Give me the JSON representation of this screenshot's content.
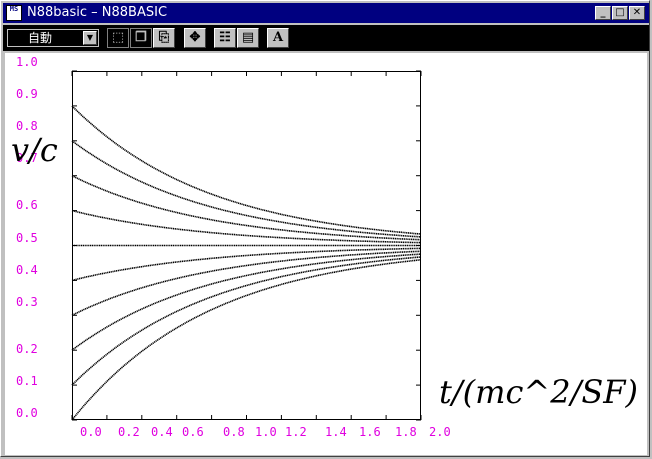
{
  "window": {
    "title": "N88basic – N88BASIC",
    "icon_text": "MS",
    "buttons": [
      "_",
      "□",
      "✕"
    ]
  },
  "toolbar": {
    "mode": "自動",
    "tools": [
      {
        "name": "select-icon",
        "glyph": "⬚"
      },
      {
        "name": "copy-icon",
        "glyph": "❐"
      },
      {
        "name": "paste-icon",
        "glyph": "⎘"
      },
      {
        "name": "fit-icon",
        "glyph": "✥"
      },
      {
        "name": "properties-icon",
        "glyph": "☷"
      },
      {
        "name": "window-icon",
        "glyph": "▤"
      },
      {
        "name": "font-icon",
        "glyph": "A"
      }
    ]
  },
  "chart_data": {
    "type": "line",
    "xlabel": "t/(mc^2/SF)",
    "ylabel": "v/c",
    "xlim": [
      0,
      2
    ],
    "ylim": [
      0,
      1
    ],
    "ytick_labels": [
      "1.0",
      "0.9",
      "0.8",
      "0.7",
      "0.6",
      "0.5",
      "0.4",
      "0.3",
      "0.2",
      "0.1",
      "0.0"
    ],
    "xtick_labels": [
      "0.0",
      "0.2",
      "0.4",
      "0.6",
      "0.8",
      "1.0",
      "1.2",
      "1.4",
      "1.6",
      "1.8",
      "2.0"
    ],
    "series_start_values": [
      0.0,
      0.1,
      0.2,
      0.3,
      0.4,
      0.5,
      0.6,
      0.7,
      0.8,
      0.9
    ],
    "limit_value": 0.5,
    "colors": {
      "tick_labels": "#e000e0",
      "lines": "#000000"
    }
  }
}
